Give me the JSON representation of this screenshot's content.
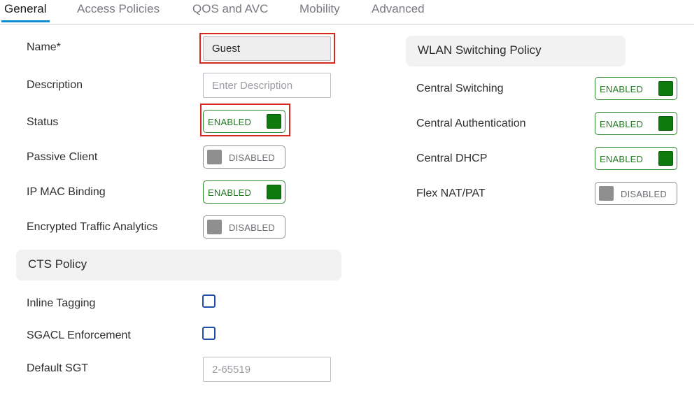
{
  "tabs": [
    {
      "label": "General",
      "active": true
    },
    {
      "label": "Access Policies"
    },
    {
      "label": "QOS and AVC"
    },
    {
      "label": "Mobility"
    },
    {
      "label": "Advanced"
    }
  ],
  "general": {
    "name": {
      "label": "Name*",
      "value": "Guest"
    },
    "description": {
      "label": "Description",
      "placeholder": "Enter Description"
    },
    "status": {
      "label": "Status",
      "state": "ENABLED"
    },
    "passive_client": {
      "label": "Passive Client",
      "state": "DISABLED"
    },
    "ip_mac_binding": {
      "label": "IP MAC Binding",
      "state": "ENABLED"
    },
    "encrypted_traffic_analytics": {
      "label": "Encrypted Traffic Analytics",
      "state": "DISABLED"
    }
  },
  "cts_policy": {
    "title": "CTS Policy",
    "inline_tagging": {
      "label": "Inline Tagging",
      "checked": false
    },
    "sgacl_enforcement": {
      "label": "SGACL Enforcement",
      "checked": false
    },
    "default_sgt": {
      "label": "Default SGT",
      "placeholder": "2-65519"
    }
  },
  "wlan_switching_policy": {
    "title": "WLAN Switching Policy",
    "central_switching": {
      "label": "Central Switching",
      "state": "ENABLED"
    },
    "central_authentication": {
      "label": "Central Authentication",
      "state": "ENABLED"
    },
    "central_dhcp": {
      "label": "Central DHCP",
      "state": "ENABLED"
    },
    "flex_nat_pat": {
      "label": "Flex NAT/PAT",
      "state": "DISABLED"
    }
  },
  "colors": {
    "accent_tab": "#0a8ccf",
    "enabled_green": "#0c7a0c",
    "highlight_red": "#d7261e",
    "checkbox_blue": "#1f4fa8"
  }
}
